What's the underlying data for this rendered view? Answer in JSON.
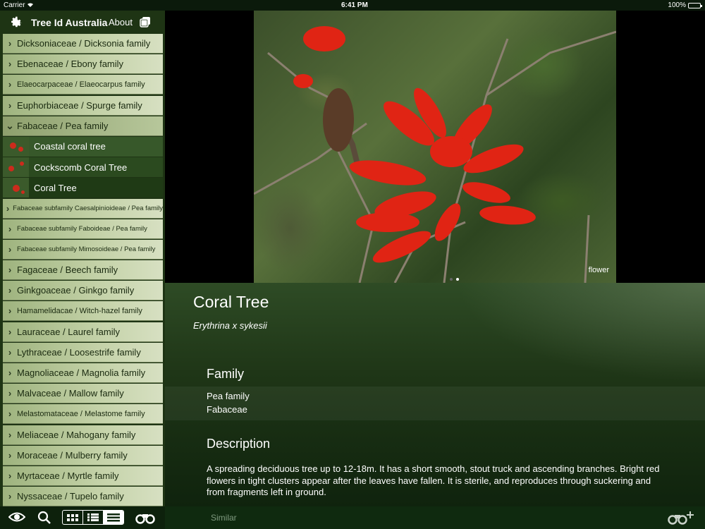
{
  "status": {
    "carrier": "Carrier",
    "time": "6:41 PM",
    "battery": "100%"
  },
  "sidebar": {
    "title": "Tree Id Australia",
    "about": "About",
    "families": [
      {
        "label": "Dicksoniaceae / Dicksonia family",
        "size": "normal"
      },
      {
        "label": "Ebenaceae / Ebony family",
        "size": "normal"
      },
      {
        "label": "Elaeocarpaceae / Elaeocarpus family",
        "size": "small"
      },
      {
        "label": "Euphorbiaceae / Spurge family",
        "size": "normal"
      },
      {
        "label": "Fabaceae / Pea family",
        "size": "normal",
        "open": true
      },
      {
        "label": "Fabaceae subfamily Caesalpinioideae / Pea family",
        "size": "tiny"
      },
      {
        "label": "Fabaceae subfamily Faboideae / Pea family",
        "size": "tiny"
      },
      {
        "label": "Fabaceae subfamily Mimosoideae / Pea family",
        "size": "tiny"
      },
      {
        "label": "Fagaceae / Beech family",
        "size": "normal"
      },
      {
        "label": "Ginkgoaceae / Ginkgo family",
        "size": "normal"
      },
      {
        "label": "Hamamelidacae / Witch-hazel family",
        "size": "small"
      },
      {
        "label": "Lauraceae / Laurel family",
        "size": "normal"
      },
      {
        "label": "Lythraceae / Loosestrife family",
        "size": "normal"
      },
      {
        "label": "Magnoliaceae / Magnolia family",
        "size": "normal"
      },
      {
        "label": "Malvaceae / Mallow family",
        "size": "normal"
      },
      {
        "label": "Melastomataceae / Melastome family",
        "size": "small"
      },
      {
        "label": "Meliaceae / Mahogany family",
        "size": "normal"
      },
      {
        "label": "Moraceae / Mulberry family",
        "size": "normal"
      },
      {
        "label": "Myrtaceae / Myrtle family",
        "size": "normal"
      },
      {
        "label": "Nyssaceae / Tupelo family",
        "size": "normal"
      }
    ],
    "open_items": [
      "Coastal coral tree",
      "Cockscomb Coral Tree",
      "Coral Tree"
    ],
    "selected_item": "Coral Tree"
  },
  "photo": {
    "caption": "flower",
    "page_count": 2,
    "current_page": 2
  },
  "detail": {
    "common_name": "Coral Tree",
    "scientific_name": "Erythrina x sykesii",
    "family_heading": "Family",
    "family_common": "Pea family",
    "family_latin": "Fabaceae",
    "description_heading": "Description",
    "description": "A spreading deciduous tree up to 12-18m. It has a short smooth, stout truck and ascending branches. Bright red flowers in tight clusters appear after the leaves have fallen. It is sterile, and reproduces through suckering and from fragments left in ground."
  },
  "toolbar": {
    "similar": "Similar"
  },
  "icons": [
    "gear-icon",
    "copy-icon",
    "eye-icon",
    "search-icon",
    "grid-view-icon",
    "list-view-icon",
    "detail-list-icon",
    "binoculars-icon",
    "binoculars-add-icon",
    "wifi-icon"
  ]
}
